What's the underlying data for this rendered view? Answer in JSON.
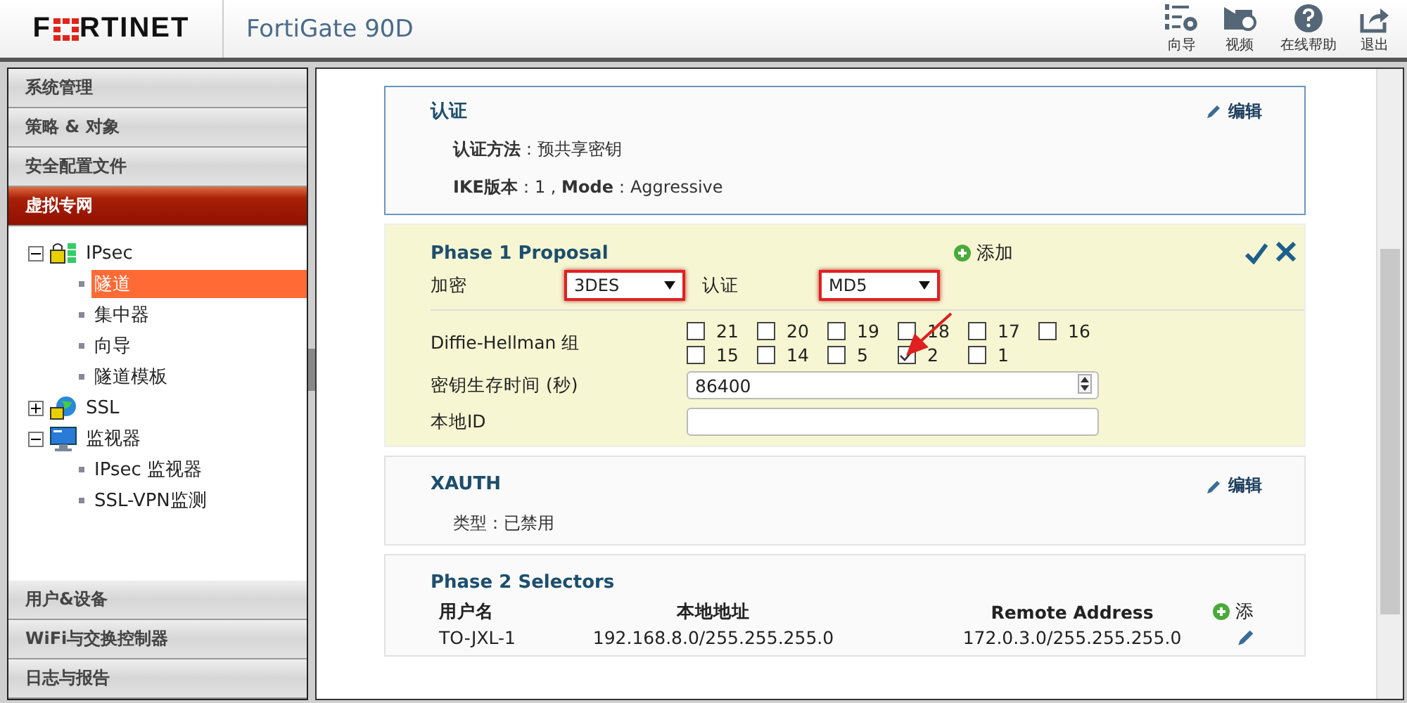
{
  "header": {
    "logo": {
      "left": "F",
      "right": "RTINET"
    },
    "title": "FortiGate 90D",
    "tools": [
      {
        "kind": "wizard",
        "label": "向导"
      },
      {
        "kind": "video",
        "label": "视频"
      },
      {
        "kind": "help",
        "label": "在线帮助"
      },
      {
        "kind": "logout",
        "label": "退出"
      }
    ]
  },
  "sidebar": {
    "top_sections": [
      {
        "label": "系统管理",
        "selected": false
      },
      {
        "label": "策略 & 对象",
        "selected": false
      },
      {
        "label": "安全配置文件",
        "selected": false
      },
      {
        "label": "虚拟专网",
        "selected": true
      }
    ],
    "tree": [
      {
        "label": "IPsec",
        "expanded": true,
        "children": [
          {
            "label": "隧道",
            "selected": true
          },
          {
            "label": "集中器",
            "selected": false
          },
          {
            "label": "向导",
            "selected": false
          },
          {
            "label": "隧道模板",
            "selected": false
          }
        ]
      },
      {
        "label": "SSL",
        "expanded": false
      },
      {
        "label": "监视器",
        "expanded": true,
        "children": [
          {
            "label": "IPsec 监视器",
            "selected": false
          },
          {
            "label": "SSL-VPN监测",
            "selected": false
          }
        ]
      }
    ],
    "bottom_sections": [
      {
        "label": "用户&设备",
        "selected": false
      },
      {
        "label": "WiFi与交换控制器",
        "selected": false
      },
      {
        "label": "日志与报告",
        "selected": false
      }
    ]
  },
  "auth": {
    "title": "认证",
    "edit": "编辑",
    "lines": [
      "**认证方法**：预共享密钥",
      "**IKE版本**：1 , **Mode**：Aggressive"
    ]
  },
  "phase1": {
    "title": "Phase 1 Proposal",
    "add": "添加",
    "encryption_label": "加密",
    "encryption": "3DES",
    "auth_label": "认证",
    "auth": "MD5",
    "dh_label": "Diffie-Hellman 组",
    "dh_groups": [
      {
        "label": "21",
        "checked": false
      },
      {
        "label": "20",
        "checked": false
      },
      {
        "label": "19",
        "checked": false
      },
      {
        "label": "18",
        "checked": false
      },
      {
        "label": "17",
        "checked": false
      },
      {
        "label": "16",
        "checked": false
      },
      {
        "label": "15",
        "checked": false
      },
      {
        "label": "14",
        "checked": false
      },
      {
        "label": "5",
        "checked": false
      },
      {
        "label": "2",
        "checked": true
      },
      {
        "label": "1",
        "checked": false
      }
    ],
    "keylife_label": "密钥生存时间 (秒)",
    "keylife": "86400",
    "local_id_label": "本地ID"
  },
  "xauth": {
    "title": "XAUTH",
    "edit": "编辑",
    "type": "类型：已禁用"
  },
  "phase2": {
    "title": "Phase 2 Selectors",
    "add": "添",
    "columns": [
      "用户名",
      "本地地址",
      "Remote Address"
    ],
    "rows": [
      {
        "name": "TO-JXL-1",
        "local": "192.168.8.0/255.255.255.0",
        "remote": "172.0.3.0/255.255.255.0"
      }
    ]
  }
}
